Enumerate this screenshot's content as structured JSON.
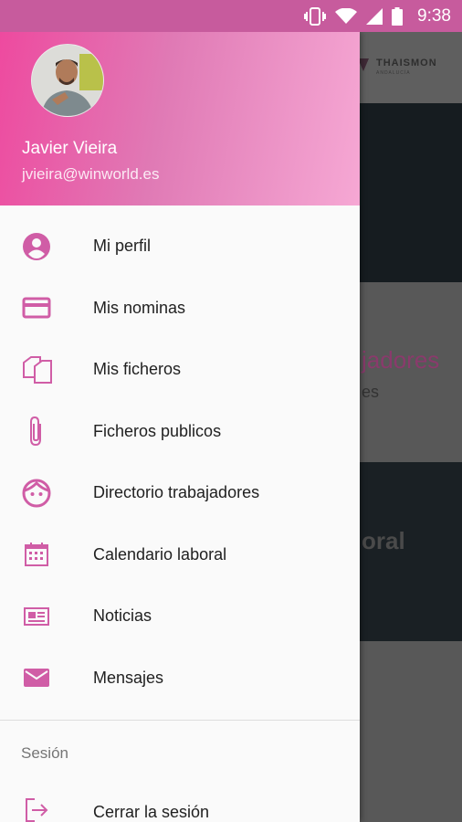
{
  "status_bar": {
    "time": "9:38",
    "icons": [
      "vibrate-icon",
      "wifi-icon",
      "signal-icon",
      "battery-icon"
    ],
    "color": "#c75b9d"
  },
  "background_app": {
    "logo_text": "THAISMON",
    "logo_sub": "ANDALUCÍA",
    "card1_title": "jadores",
    "card1_sub": "es",
    "card2_title": "oral"
  },
  "drawer": {
    "user": {
      "name": "Javier Vieira",
      "email": "jvieira@winworld.es"
    },
    "accent_color": "#d05da6",
    "items": [
      {
        "label": "Mi perfil",
        "icon": "account-circle-icon"
      },
      {
        "label": "Mis nominas",
        "icon": "credit-card-icon"
      },
      {
        "label": "Mis ficheros",
        "icon": "files-icon"
      },
      {
        "label": "Ficheros publicos",
        "icon": "paperclip-icon"
      },
      {
        "label": "Directorio trabajadores",
        "icon": "face-icon"
      },
      {
        "label": "Calendario laboral",
        "icon": "calendar-icon"
      },
      {
        "label": "Noticias",
        "icon": "news-icon"
      },
      {
        "label": "Mensajes",
        "icon": "mail-icon"
      }
    ],
    "section_title": "Sesión",
    "logout_label": "Cerrar la sesión",
    "logout_icon": "logout-icon"
  }
}
